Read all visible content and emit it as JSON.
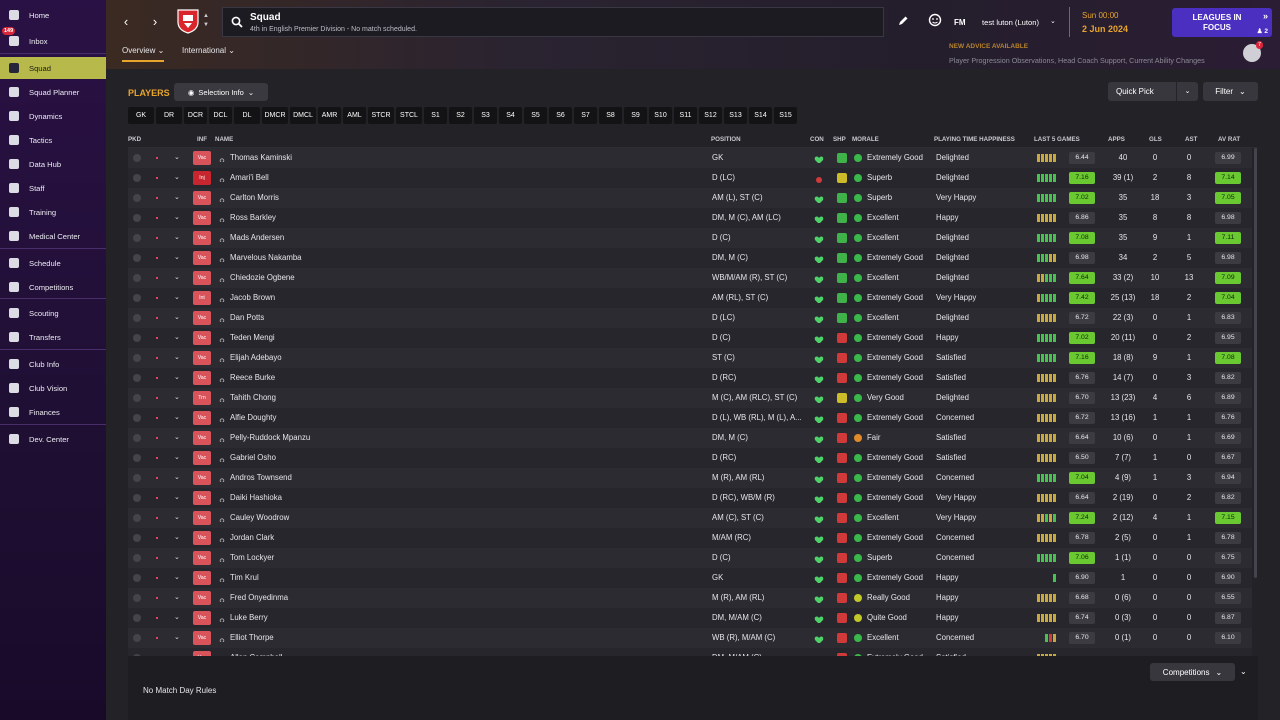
{
  "sidebar": {
    "items": [
      {
        "label": "Home",
        "icon": "home-icon",
        "badge": ""
      },
      {
        "label": "Inbox",
        "icon": "inbox-icon",
        "badge": "149"
      },
      {
        "label": "Squad",
        "icon": "squad-shirt-icon",
        "badge": ""
      },
      {
        "label": "Squad Planner",
        "icon": "planner-icon",
        "badge": ""
      },
      {
        "label": "Dynamics",
        "icon": "dynamics-icon",
        "badge": ""
      },
      {
        "label": "Tactics",
        "icon": "tactics-icon",
        "badge": ""
      },
      {
        "label": "Data Hub",
        "icon": "data-hub-icon",
        "badge": ""
      },
      {
        "label": "Staff",
        "icon": "staff-icon",
        "badge": ""
      },
      {
        "label": "Training",
        "icon": "training-icon",
        "badge": ""
      },
      {
        "label": "Medical Center",
        "icon": "medical-icon",
        "badge": ""
      },
      {
        "label": "Schedule",
        "icon": "calendar-icon",
        "badge": ""
      },
      {
        "label": "Competitions",
        "icon": "trophy-icon",
        "badge": ""
      },
      {
        "label": "Scouting",
        "icon": "scouting-icon",
        "badge": ""
      },
      {
        "label": "Transfers",
        "icon": "transfers-icon",
        "badge": ""
      },
      {
        "label": "Club Info",
        "icon": "club-shield-icon",
        "badge": ""
      },
      {
        "label": "Club Vision",
        "icon": "vision-icon",
        "badge": ""
      },
      {
        "label": "Finances",
        "icon": "finances-icon",
        "badge": ""
      },
      {
        "label": "Dev. Center",
        "icon": "dev-center-icon",
        "badge": ""
      }
    ]
  },
  "header": {
    "title": "Squad",
    "subtitle": "4th in English Premier Division - No match scheduled.",
    "tabs": [
      {
        "label": "Overview"
      },
      {
        "label": "International"
      }
    ],
    "fm_label": "FM",
    "save_name": "test luton (Luton)",
    "day": "Sun 00:00",
    "date": "2 Jun 2024",
    "continue_line1": "LEAGUES IN",
    "continue_line2": "FOCUS",
    "continue_count": "2",
    "advice_title": "NEW ADVICE AVAILABLE",
    "advice_text": "Player Progression Observations, Head Coach Support, Current Ability Changes",
    "staff_count": "7",
    "accent_color": "#e8a52c",
    "continue_color": "#4a2fc0"
  },
  "toolbar": {
    "players_label": "PLAYERS",
    "selection_info": "Selection Info",
    "quick_pick": "Quick Pick",
    "filter": "Filter",
    "positions": [
      "GK",
      "DR",
      "DCR",
      "DCL",
      "DL",
      "DMCR",
      "DMCL",
      "AMR",
      "AML",
      "STCR",
      "STCL",
      "S1",
      "S2",
      "S3",
      "S4",
      "S5",
      "S6",
      "S7",
      "S8",
      "S9",
      "S10",
      "S11",
      "S12",
      "S13",
      "S14",
      "S15"
    ]
  },
  "table": {
    "headers": {
      "pkd": "PKD",
      "inf": "INF",
      "name": "NAME",
      "position": "POSITION",
      "con": "CON",
      "shp": "SHP",
      "morale": "MORALE",
      "happiness": "PLAYING TIME HAPPINESS",
      "last5": "LAST 5 GAMES",
      "apps": "APPS",
      "gls": "GLS",
      "ast": "AST",
      "avrat": "AV RAT"
    },
    "rows": [
      {
        "inf": "Vac",
        "name": "Thomas Kaminski",
        "pos": "GK",
        "shp": "up",
        "morale": "Extremely Good",
        "mood": "good",
        "happiness": "Delighted",
        "form": "yyyyy",
        "frat": "6.44",
        "frat_hi": false,
        "apps": "40",
        "gls": "0",
        "ast": "0",
        "avrat": "6.99",
        "avrat_hi": false
      },
      {
        "inf": "Inj",
        "name": "Amari'i Bell",
        "pos": "D (LC)",
        "shp": "mid",
        "morale": "Superb",
        "mood": "good",
        "happiness": "Delighted",
        "form": "ggggg",
        "frat": "7.16",
        "frat_hi": true,
        "apps": "39 (1)",
        "gls": "2",
        "ast": "8",
        "avrat": "7.14",
        "avrat_hi": true
      },
      {
        "inf": "Vac",
        "name": "Carlton Morris",
        "pos": "AM (L), ST (C)",
        "shp": "up",
        "morale": "Superb",
        "mood": "good",
        "happiness": "Very Happy",
        "form": "ggggg",
        "frat": "7.02",
        "frat_hi": true,
        "apps": "35",
        "gls": "18",
        "ast": "3",
        "avrat": "7.05",
        "avrat_hi": true
      },
      {
        "inf": "Vac",
        "name": "Ross Barkley",
        "pos": "DM, M (C), AM (LC)",
        "shp": "up",
        "morale": "Excellent",
        "mood": "good",
        "happiness": "Happy",
        "form": "yyyyy",
        "frat": "6.86",
        "frat_hi": false,
        "apps": "35",
        "gls": "8",
        "ast": "8",
        "avrat": "6.98",
        "avrat_hi": false
      },
      {
        "inf": "Vac",
        "name": "Mads Andersen",
        "pos": "D (C)",
        "shp": "up",
        "morale": "Excellent",
        "mood": "good",
        "happiness": "Delighted",
        "form": "ggggg",
        "frat": "7.08",
        "frat_hi": true,
        "apps": "35",
        "gls": "9",
        "ast": "1",
        "avrat": "7.11",
        "avrat_hi": true
      },
      {
        "inf": "Vac",
        "name": "Marvelous Nakamba",
        "pos": "DM, M (C)",
        "shp": "up",
        "morale": "Extremely Good",
        "mood": "good",
        "happiness": "Delighted",
        "form": "gggyy",
        "frat": "6.98",
        "frat_hi": false,
        "apps": "34",
        "gls": "2",
        "ast": "5",
        "avrat": "6.98",
        "avrat_hi": false
      },
      {
        "inf": "Vac",
        "name": "Chiedozie Ogbene",
        "pos": "WB/M/AM (R), ST (C)",
        "shp": "up",
        "morale": "Excellent",
        "mood": "good",
        "happiness": "Delighted",
        "form": "yyggg",
        "frat": "7.64",
        "frat_hi": true,
        "apps": "33 (2)",
        "gls": "10",
        "ast": "13",
        "avrat": "7.09",
        "avrat_hi": true
      },
      {
        "inf": "Int",
        "name": "Jacob Brown",
        "pos": "AM (RL), ST (C)",
        "shp": "up",
        "morale": "Extremely Good",
        "mood": "good",
        "happiness": "Very Happy",
        "form": "ygggg",
        "frat": "7.42",
        "frat_hi": true,
        "apps": "25 (13)",
        "gls": "18",
        "ast": "2",
        "avrat": "7.04",
        "avrat_hi": true
      },
      {
        "inf": "Vac",
        "name": "Dan Potts",
        "pos": "D (LC)",
        "shp": "up",
        "morale": "Excellent",
        "mood": "good",
        "happiness": "Delighted",
        "form": "yyyyy",
        "frat": "6.72",
        "frat_hi": false,
        "apps": "22 (3)",
        "gls": "0",
        "ast": "1",
        "avrat": "6.83",
        "avrat_hi": false
      },
      {
        "inf": "Vac",
        "name": "Teden Mengi",
        "pos": "D (C)",
        "shp": "down",
        "morale": "Extremely Good",
        "mood": "good",
        "happiness": "Happy",
        "form": "ggggg",
        "frat": "7.02",
        "frat_hi": true,
        "apps": "20 (11)",
        "gls": "0",
        "ast": "2",
        "avrat": "6.95",
        "avrat_hi": false
      },
      {
        "inf": "Vac",
        "name": "Elijah Adebayo",
        "pos": "ST (C)",
        "shp": "down",
        "morale": "Extremely Good",
        "mood": "good",
        "happiness": "Satisfied",
        "form": "ggggg",
        "frat": "7.16",
        "frat_hi": true,
        "apps": "18 (8)",
        "gls": "9",
        "ast": "1",
        "avrat": "7.08",
        "avrat_hi": true
      },
      {
        "inf": "Vac",
        "name": "Reece Burke",
        "pos": "D (RC)",
        "shp": "down",
        "morale": "Extremely Good",
        "mood": "good",
        "happiness": "Satisfied",
        "form": "yyyyy",
        "frat": "6.76",
        "frat_hi": false,
        "apps": "14 (7)",
        "gls": "0",
        "ast": "3",
        "avrat": "6.82",
        "avrat_hi": false
      },
      {
        "inf": "Trn",
        "name": "Tahith Chong",
        "pos": "M (C), AM (RLC), ST (C)",
        "shp": "mid",
        "morale": "Very Good",
        "mood": "good",
        "happiness": "Delighted",
        "form": "yyyyy",
        "frat": "6.70",
        "frat_hi": false,
        "apps": "13 (23)",
        "gls": "4",
        "ast": "6",
        "avrat": "6.89",
        "avrat_hi": false
      },
      {
        "inf": "Vac",
        "name": "Alfie Doughty",
        "pos": "D (L), WB (RL), M (L), A...",
        "shp": "down",
        "morale": "Extremely Good",
        "mood": "good",
        "happiness": "Concerned",
        "form": "yyyyy",
        "frat": "6.72",
        "frat_hi": false,
        "apps": "13 (16)",
        "gls": "1",
        "ast": "1",
        "avrat": "6.76",
        "avrat_hi": false
      },
      {
        "inf": "Vac",
        "name": "Pelly-Ruddock Mpanzu",
        "pos": "DM, M (C)",
        "shp": "down",
        "morale": "Fair",
        "mood": "poor",
        "happiness": "Satisfied",
        "form": "yyyyy",
        "frat": "6.64",
        "frat_hi": false,
        "apps": "10 (6)",
        "gls": "0",
        "ast": "1",
        "avrat": "6.69",
        "avrat_hi": false
      },
      {
        "inf": "Vac",
        "name": "Gabriel Osho",
        "pos": "D (RC)",
        "shp": "down",
        "morale": "Extremely Good",
        "mood": "good",
        "happiness": "Satisfied",
        "form": "yyyyy",
        "frat": "6.50",
        "frat_hi": false,
        "apps": "7 (7)",
        "gls": "1",
        "ast": "0",
        "avrat": "6.67",
        "avrat_hi": false
      },
      {
        "inf": "Vac",
        "name": "Andros Townsend",
        "pos": "M (R), AM (RL)",
        "shp": "down",
        "morale": "Extremely Good",
        "mood": "good",
        "happiness": "Concerned",
        "form": "ggggg",
        "frat": "7.04",
        "frat_hi": true,
        "apps": "4 (9)",
        "gls": "1",
        "ast": "3",
        "avrat": "6.94",
        "avrat_hi": false
      },
      {
        "inf": "Vac",
        "name": "Daiki Hashioka",
        "pos": "D (RC), WB/M (R)",
        "shp": "down",
        "morale": "Extremely Good",
        "mood": "good",
        "happiness": "Very Happy",
        "form": "yyyyy",
        "frat": "6.64",
        "frat_hi": false,
        "apps": "2 (19)",
        "gls": "0",
        "ast": "2",
        "avrat": "6.82",
        "avrat_hi": false
      },
      {
        "inf": "Vac",
        "name": "Cauley Woodrow",
        "pos": "AM (C), ST (C)",
        "shp": "down",
        "morale": "Excellent",
        "mood": "good",
        "happiness": "Very Happy",
        "form": "yygyg",
        "frat": "7.24",
        "frat_hi": true,
        "apps": "2 (12)",
        "gls": "4",
        "ast": "1",
        "avrat": "7.15",
        "avrat_hi": true
      },
      {
        "inf": "Vac",
        "name": "Jordan Clark",
        "pos": "M/AM (RC)",
        "shp": "down",
        "morale": "Extremely Good",
        "mood": "good",
        "happiness": "Concerned",
        "form": "yyyyy",
        "frat": "6.78",
        "frat_hi": false,
        "apps": "2 (5)",
        "gls": "0",
        "ast": "1",
        "avrat": "6.78",
        "avrat_hi": false
      },
      {
        "inf": "Vac",
        "name": "Tom Lockyer",
        "pos": "D (C)",
        "shp": "down",
        "morale": "Superb",
        "mood": "good",
        "happiness": "Concerned",
        "form": "ggggg",
        "frat": "7.06",
        "frat_hi": true,
        "apps": "1 (1)",
        "gls": "0",
        "ast": "0",
        "avrat": "6.75",
        "avrat_hi": false
      },
      {
        "inf": "Vac",
        "name": "Tim Krul",
        "pos": "GK",
        "shp": "down",
        "morale": "Extremely Good",
        "mood": "good",
        "happiness": "Happy",
        "form": "eeeeg",
        "frat": "6.90",
        "frat_hi": false,
        "apps": "1",
        "gls": "0",
        "ast": "0",
        "avrat": "6.90",
        "avrat_hi": false
      },
      {
        "inf": "Vac",
        "name": "Fred Onyedinma",
        "pos": "M (R), AM (RL)",
        "shp": "down",
        "morale": "Really Good",
        "mood": "okay",
        "happiness": "Happy",
        "form": "yyyyy",
        "frat": "6.68",
        "frat_hi": false,
        "apps": "0 (6)",
        "gls": "0",
        "ast": "0",
        "avrat": "6.55",
        "avrat_hi": false
      },
      {
        "inf": "Vac",
        "name": "Luke Berry",
        "pos": "DM, M/AM (C)",
        "shp": "down",
        "morale": "Quite Good",
        "mood": "okay",
        "happiness": "Happy",
        "form": "yyyyy",
        "frat": "6.74",
        "frat_hi": false,
        "apps": "0 (3)",
        "gls": "0",
        "ast": "0",
        "avrat": "6.87",
        "avrat_hi": false
      },
      {
        "inf": "Vac",
        "name": "Elliot Thorpe",
        "pos": "WB (R), M/AM (C)",
        "shp": "down",
        "morale": "Excellent",
        "mood": "good",
        "happiness": "Concerned",
        "form": "eegry",
        "frat": "6.70",
        "frat_hi": false,
        "apps": "0 (1)",
        "gls": "0",
        "ast": "0",
        "avrat": "6.10",
        "avrat_hi": false
      },
      {
        "inf": "Vac",
        "name": "Allan Campbell",
        "pos": "DM, M/AM (C)",
        "shp": "down",
        "morale": "Extremely Good",
        "mood": "good",
        "happiness": "Satisfied",
        "form": "yyyyy",
        "frat": "",
        "frat_hi": false,
        "apps": "",
        "gls": "",
        "ast": "",
        "avrat": "",
        "avrat_hi": false
      }
    ]
  },
  "footer": {
    "text": "No Match Day Rules",
    "competitions": "Competitions"
  }
}
